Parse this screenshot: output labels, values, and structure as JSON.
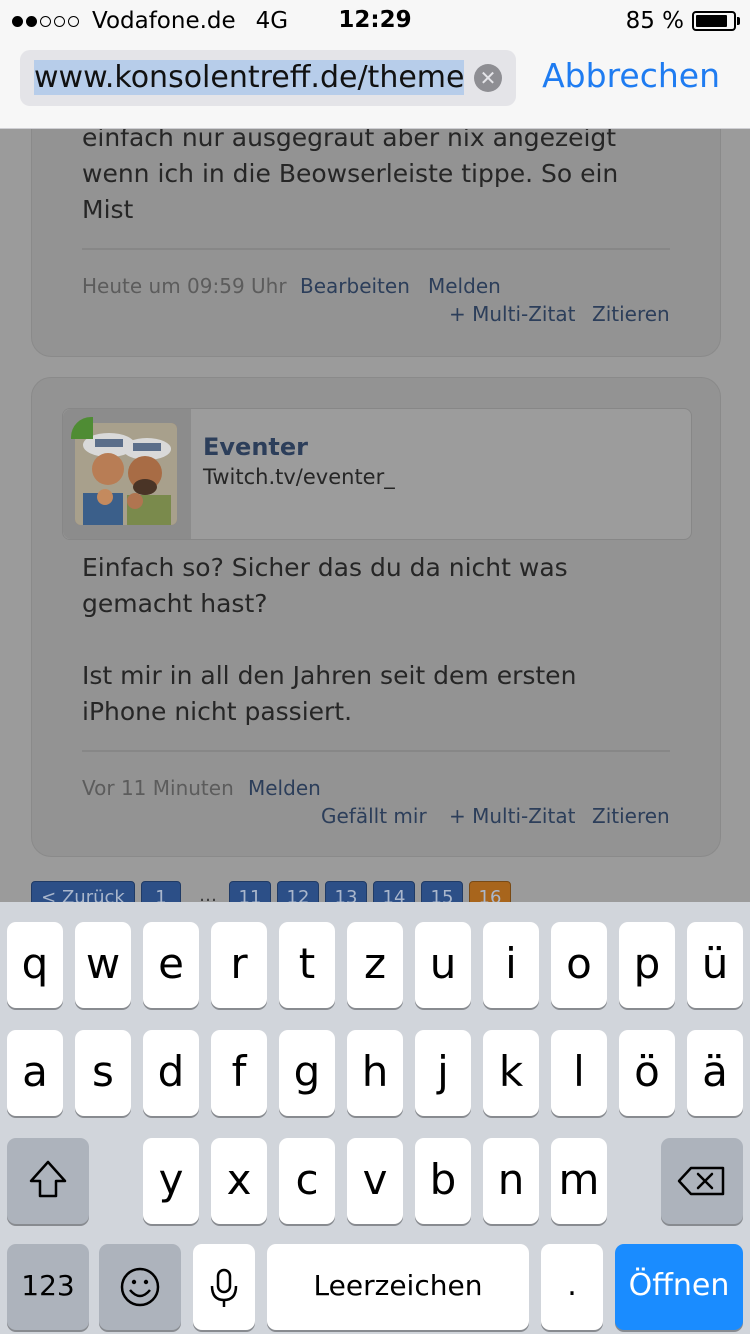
{
  "status_bar": {
    "carrier": "Vodafone.de",
    "network": "4G",
    "time": "12:29",
    "battery": "85 %",
    "battery_level": 0.85
  },
  "url_bar": {
    "url": "www.konsolentreff.de/themen/i",
    "cancel_label": "Abbrechen"
  },
  "post1": {
    "text_lines": [
      "einfach nur ausgegraut aber nix angezeigt",
      "wenn ich in die Beowserleiste tippe. So ein",
      "Mist"
    ],
    "timestamp": "Heute um 09:59 Uhr",
    "edit_label": "Bearbeiten",
    "report_label": "Melden",
    "multiquote_label": "+ Multi-Zitat",
    "quote_label": "Zitieren"
  },
  "post2": {
    "username": "Eventer",
    "user_subtitle": "Twitch.tv/eventer_",
    "text_lines": [
      "Einfach so? Sicher das du da nicht was",
      "gemacht hast?",
      "",
      "Ist mir in all den Jahren seit dem ersten",
      "iPhone nicht passiert."
    ],
    "timestamp": "Vor 11 Minuten",
    "report_label": "Melden",
    "like_label": "Gefällt mir",
    "multiquote_label": "+ Multi-Zitat",
    "quote_label": "Zitieren"
  },
  "pagination": {
    "back_label": "< Zurück",
    "first_page": "1",
    "ellipsis": "…",
    "pages": [
      "11",
      "12",
      "13",
      "14",
      "15",
      "16"
    ],
    "current_page": "16"
  },
  "keyboard": {
    "row1": [
      "q",
      "w",
      "e",
      "r",
      "t",
      "z",
      "u",
      "i",
      "o",
      "p",
      "ü"
    ],
    "row2": [
      "a",
      "s",
      "d",
      "f",
      "g",
      "h",
      "j",
      "k",
      "l",
      "ö",
      "ä"
    ],
    "row3": [
      "y",
      "x",
      "c",
      "v",
      "b",
      "n",
      "m"
    ],
    "numbers_label": "123",
    "space_label": "Leerzeichen",
    "period_label": ".",
    "go_label": "Öffnen",
    "shift_icon": "shift-icon",
    "backspace_icon": "backspace-icon",
    "emoji_icon": "emoji-icon",
    "mic_icon": "microphone-icon"
  }
}
